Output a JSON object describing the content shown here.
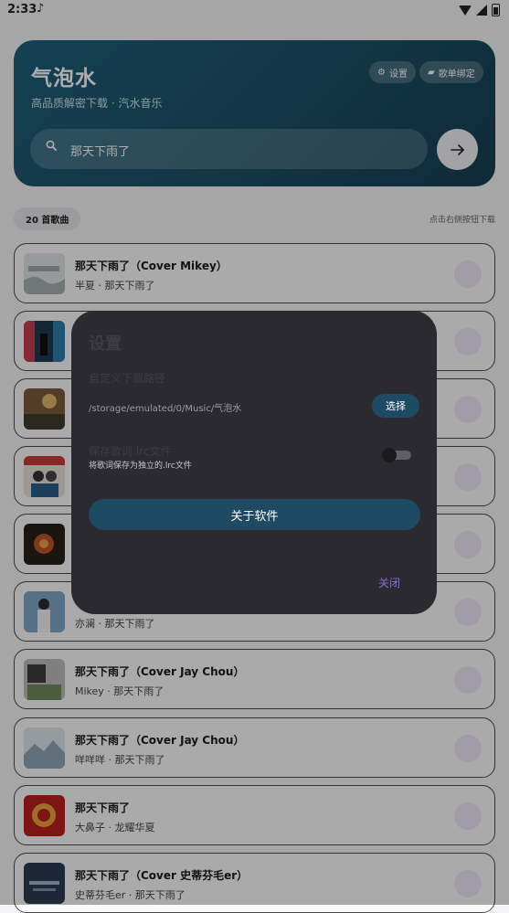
{
  "status_bar": {
    "time": "2:33",
    "music_note": "♪"
  },
  "header": {
    "title": "气泡水",
    "subtitle": "高品质解密下载 · 汽水音乐",
    "settings_label": "设置",
    "bind_label": "歌单绑定",
    "search_value": "那天下雨了"
  },
  "list_info": {
    "count_label": "20 首歌曲",
    "hint": "点击右侧按钮下载"
  },
  "songs": [
    {
      "title": "那天下雨了（Cover Mikey）",
      "subtitle": "半夏 · 那天下雨了"
    },
    {
      "title": "",
      "subtitle": ""
    },
    {
      "title": "",
      "subtitle": ""
    },
    {
      "title": "",
      "subtitle": ""
    },
    {
      "title": "",
      "subtitle": ""
    },
    {
      "title": "",
      "subtitle": "亦澜 · 那天下雨了"
    },
    {
      "title": "那天下雨了（Cover Jay Chou）",
      "subtitle": "Mikey · 那天下雨了"
    },
    {
      "title": "那天下雨了（Cover Jay Chou）",
      "subtitle": "咩咩咩 · 那天下雨了"
    },
    {
      "title": "那天下雨了",
      "subtitle": "大鼻子 · 龙耀华夏"
    },
    {
      "title": "那天下雨了（Cover 史蒂芬毛er）",
      "subtitle": "史蒂芬毛er · 那天下雨了"
    }
  ],
  "dialog": {
    "title": "设置",
    "download_path_label": "自定义下载路径",
    "download_path_value": "/storage/emulated/0/Music/气泡水",
    "choose_label": "选择",
    "save_lrc_label": "保存歌词.lrc文件",
    "save_lrc_desc": "将歌词保存为独立的.lrc文件",
    "save_lrc_enabled": false,
    "about_label": "关于软件",
    "close_label": "关闭"
  },
  "colors": {
    "accent": "#1e4a63",
    "header_bg": "#1c4f66",
    "close_text": "#8a6cd4",
    "dialog_bg": "#2a2a30"
  }
}
